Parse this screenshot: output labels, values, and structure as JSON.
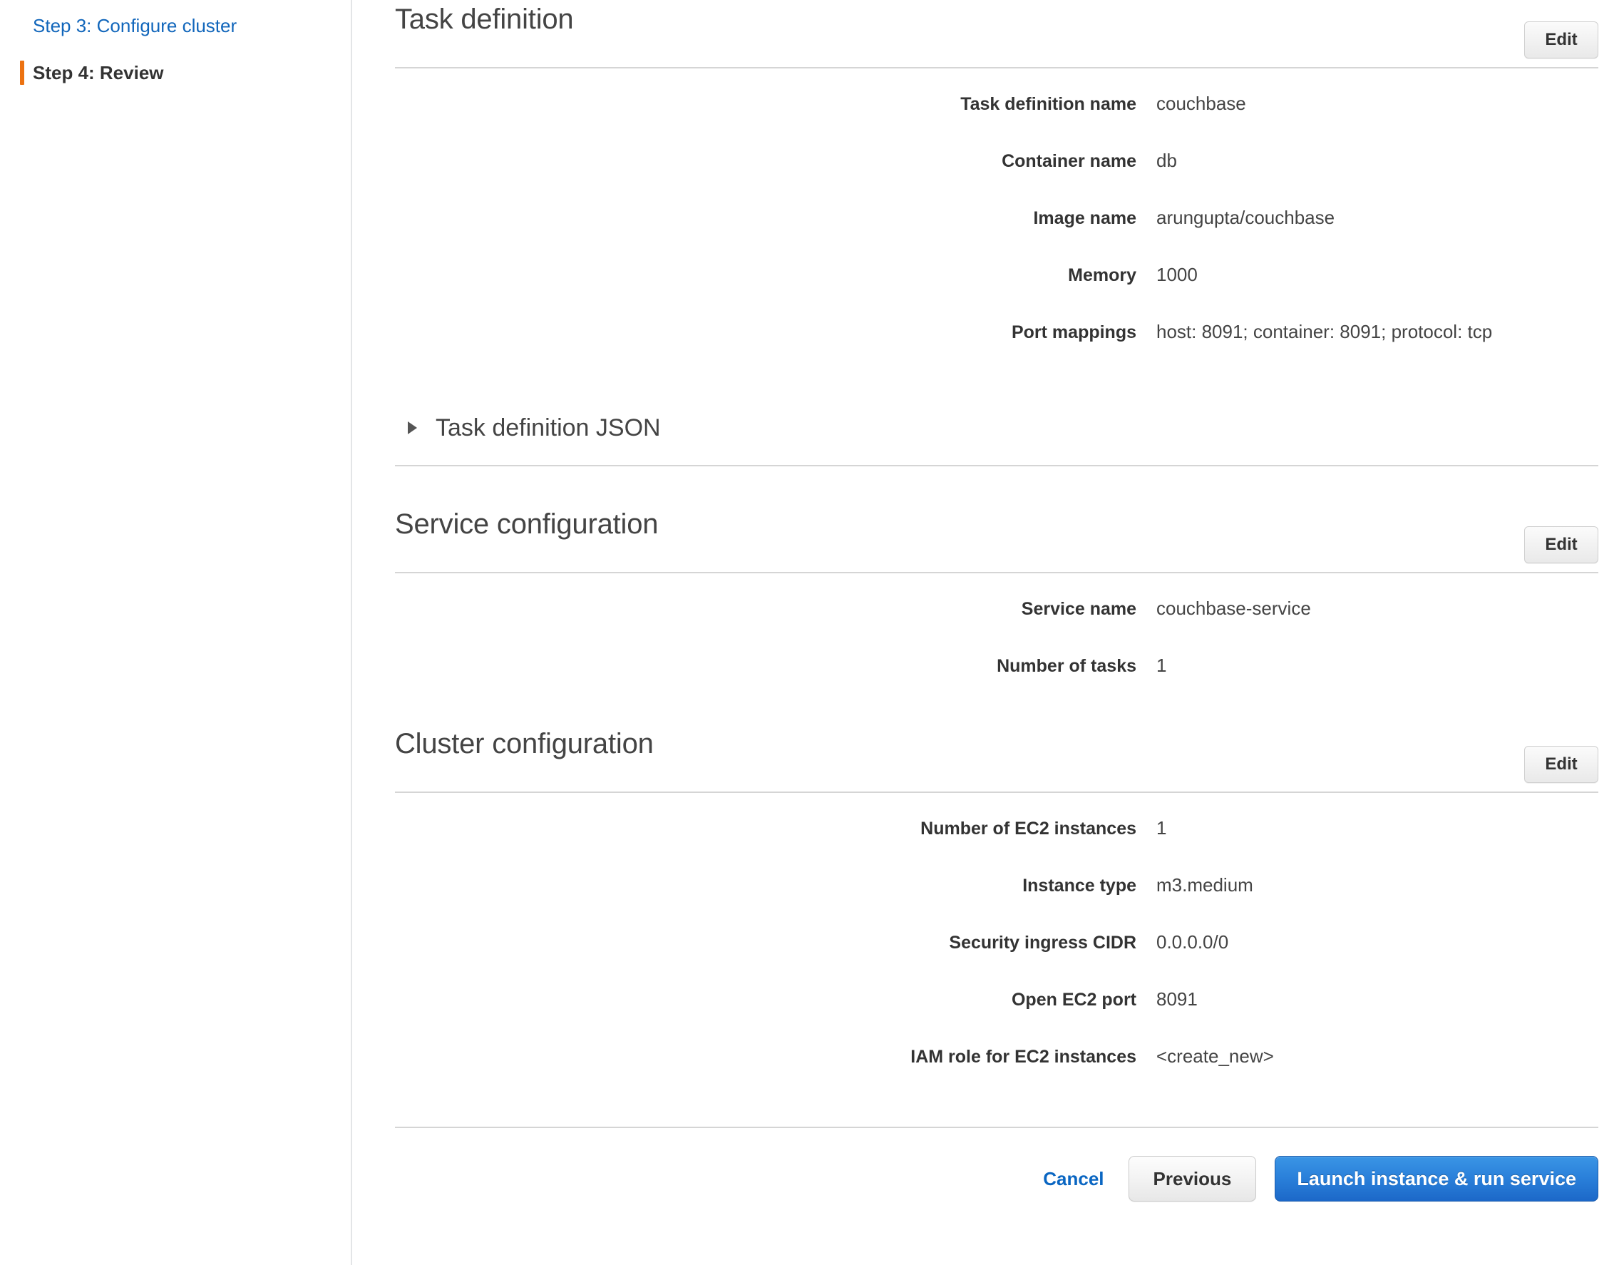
{
  "sidebar": {
    "steps": [
      {
        "label": "Step 3: Configure cluster",
        "state": "link"
      },
      {
        "label": "Step 4: Review",
        "state": "current"
      }
    ]
  },
  "sections": {
    "task_definition": {
      "title": "Task definition",
      "edit_label": "Edit",
      "fields": [
        {
          "label": "Task definition name",
          "value": "couchbase"
        },
        {
          "label": "Container name",
          "value": "db"
        },
        {
          "label": "Image name",
          "value": "arungupta/couchbase"
        },
        {
          "label": "Memory",
          "value": "1000"
        },
        {
          "label": "Port mappings",
          "value": "host: 8091; container: 8091; protocol: tcp"
        }
      ],
      "disclosure_label": "Task definition JSON",
      "disclosure_expanded": "false"
    },
    "service_configuration": {
      "title": "Service configuration",
      "edit_label": "Edit",
      "fields": [
        {
          "label": "Service name",
          "value": "couchbase-service"
        },
        {
          "label": "Number of tasks",
          "value": "1"
        }
      ]
    },
    "cluster_configuration": {
      "title": "Cluster configuration",
      "edit_label": "Edit",
      "fields": [
        {
          "label": "Number of EC2 instances",
          "value": "1"
        },
        {
          "label": "Instance type",
          "value": "m3.medium"
        },
        {
          "label": "Security ingress CIDR",
          "value": "0.0.0.0/0"
        },
        {
          "label": "Open EC2 port",
          "value": "8091"
        },
        {
          "label": "IAM role for EC2 instances",
          "value": "<create_new>"
        }
      ]
    }
  },
  "footer": {
    "cancel_label": "Cancel",
    "previous_label": "Previous",
    "submit_label": "Launch instance & run service"
  },
  "colors": {
    "link": "#1166bb",
    "current_step_marker": "#ec7211",
    "primary_button": "#2a80da",
    "heading_text": "#444444",
    "label_text": "#333333",
    "divider": "#d5d5d5"
  }
}
